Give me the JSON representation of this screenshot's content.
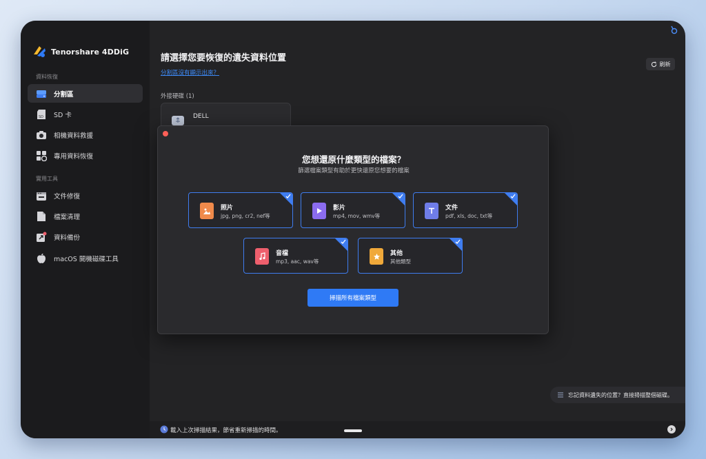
{
  "app": {
    "name": "Tenorshare 4DDiG",
    "accent_color": "#2f7af5",
    "logo_icon": "4ddig-logo-icon"
  },
  "sidebar": {
    "section_recovery": "資料恢復",
    "section_tools": "實用工具",
    "items": [
      {
        "label": "分割區",
        "icon": "drive-icon",
        "active": true
      },
      {
        "label": "SD 卡",
        "icon": "sd-card-icon",
        "active": false
      },
      {
        "label": "相機資料救援",
        "icon": "camera-icon",
        "active": false
      },
      {
        "label": "專用資料恢復",
        "icon": "special-recovery-icon",
        "active": false
      },
      {
        "label": "文件修復",
        "icon": "file-repair-icon",
        "active": false
      },
      {
        "label": "檔案清理",
        "icon": "file-clean-icon",
        "active": false
      },
      {
        "label": "資料備份",
        "icon": "backup-icon",
        "active": false
      },
      {
        "label": "macOS 開機磁碟工具",
        "icon": "apple-icon",
        "active": false
      }
    ]
  },
  "main": {
    "title": "請選擇您要恢復的遺失資料位置",
    "link": "分割區沒有顯示出來？",
    "refresh_label": "刷新",
    "external_label": "外接硬碟 (1)",
    "drive_name": "DELL"
  },
  "modal": {
    "title": "您想還原什麼類型的檔案？",
    "subtitle": "篩選檔案類型有助於更快還原您想要的檔案",
    "types": [
      {
        "name": "照片",
        "ext": "jpg, png, cr2, nef等",
        "icon": "photo-icon",
        "color": "#f08a4b",
        "checked": true
      },
      {
        "name": "影片",
        "ext": "mp4, mov, wmv等",
        "icon": "video-icon",
        "color": "#8b6cf0",
        "checked": true
      },
      {
        "name": "文件",
        "ext": "pdf, xls, doc, txt等",
        "icon": "document-icon",
        "color": "#6f7de8",
        "checked": true
      },
      {
        "name": "音檔",
        "ext": "mp3, aac, wav等",
        "icon": "audio-icon",
        "color": "#ee5f6d",
        "checked": true
      },
      {
        "name": "其他",
        "ext": "其他類型",
        "icon": "other-icon",
        "color": "#f0a93a",
        "checked": true
      }
    ],
    "scan_label": "掃描所有檔案類型"
  },
  "hint": {
    "text": "忘記資料遺失的位置？直接掃描整個磁碟。"
  },
  "bottom": {
    "text": "載入上次掃描結果，節省重新掃描的時間。"
  }
}
